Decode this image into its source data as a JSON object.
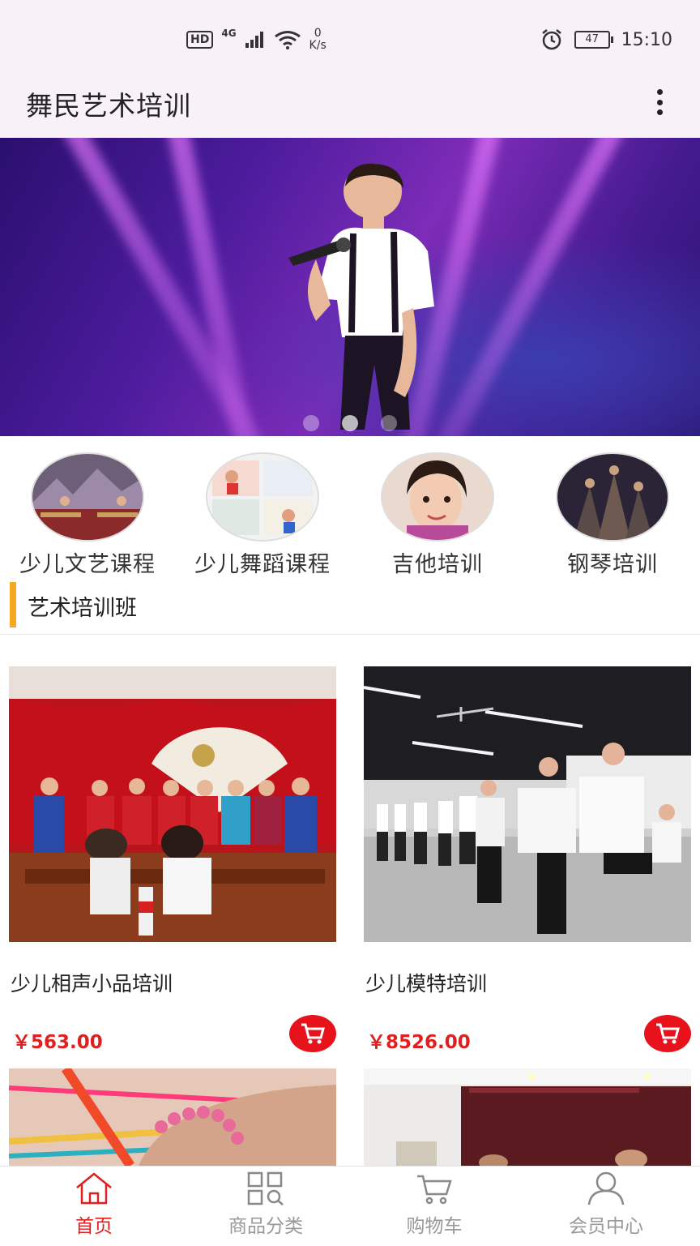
{
  "status_bar": {
    "hd": "HD",
    "network": "4G",
    "speed_value": "0",
    "speed_unit": "K/s",
    "battery": "47",
    "time": "15:10"
  },
  "app_bar": {
    "title": "舞民艺术培训",
    "menu_icon": "more-vert-icon"
  },
  "banner": {
    "slide_count": 3,
    "active_slide": 2
  },
  "categories": [
    {
      "label": "少儿文艺课程"
    },
    {
      "label": "少儿舞蹈课程"
    },
    {
      "label": "吉他培训"
    },
    {
      "label": "钢琴培训"
    }
  ],
  "section": {
    "title": "艺术培训班"
  },
  "products": [
    {
      "title": "少儿相声小品培训",
      "price": "￥563.00"
    },
    {
      "title": "少儿模特培训",
      "price": "￥8526.00"
    },
    {
      "title": "",
      "price": ""
    },
    {
      "title": "",
      "price": ""
    }
  ],
  "bottom_nav": [
    {
      "label": "首页",
      "icon": "home-icon",
      "active": true
    },
    {
      "label": "商品分类",
      "icon": "grid-search-icon",
      "active": false
    },
    {
      "label": "购物车",
      "icon": "cart-icon",
      "active": false
    },
    {
      "label": "会员中心",
      "icon": "user-icon",
      "active": false
    }
  ],
  "colors": {
    "accent": "#e02020",
    "section_bar": "#f5a623",
    "app_bar_bg": "#f8f2f8"
  }
}
